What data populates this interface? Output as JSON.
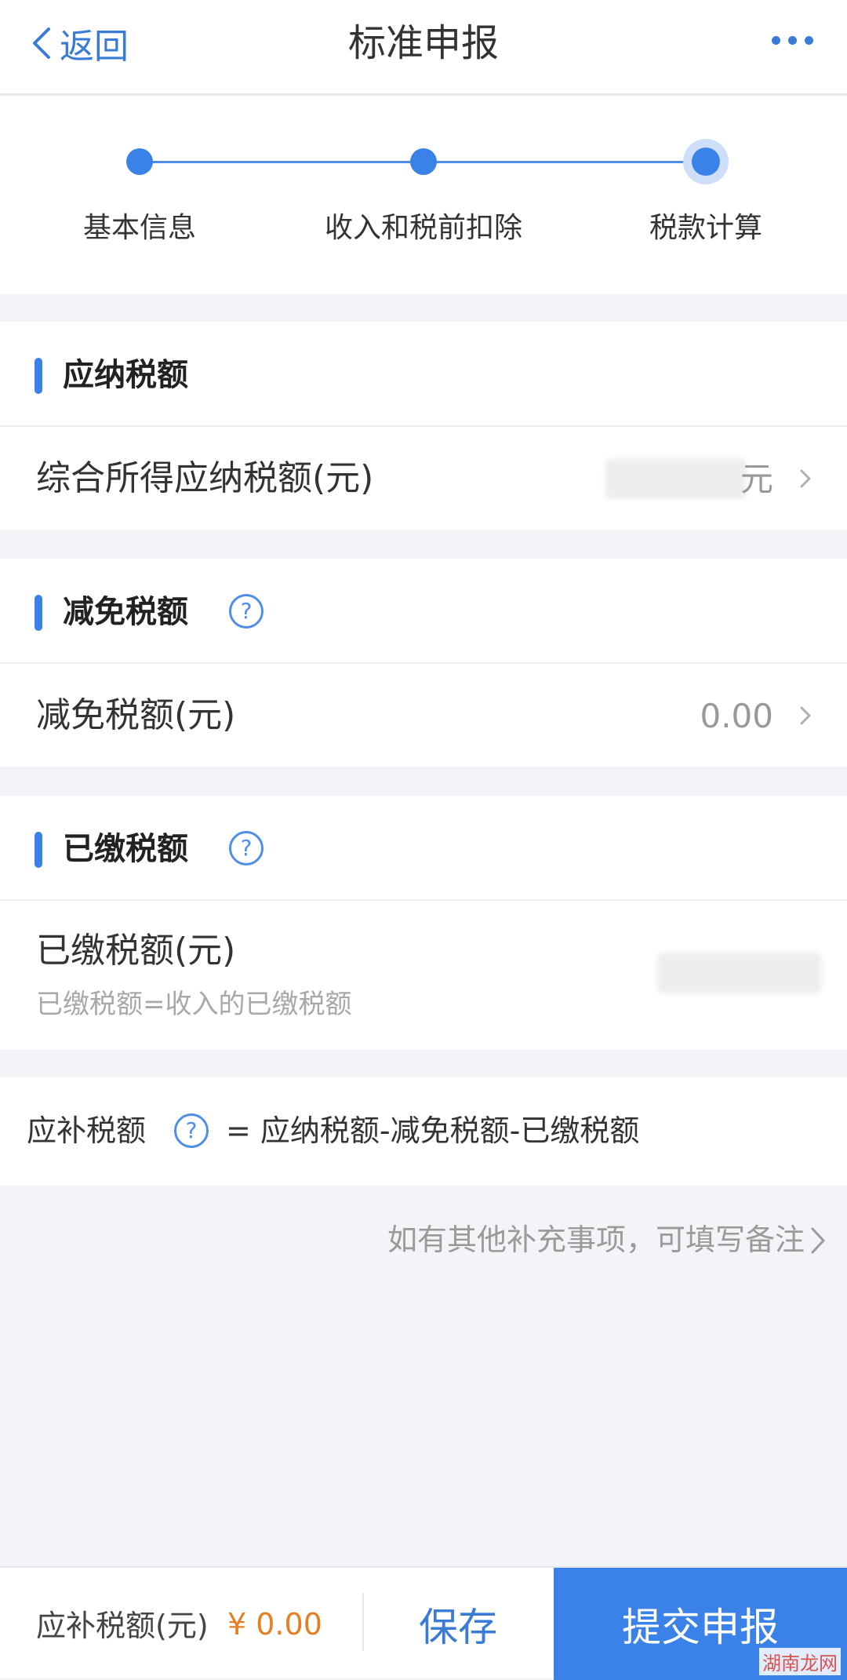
{
  "header": {
    "back_label": "返回",
    "title": "标准申报"
  },
  "stepper": {
    "steps": [
      "基本信息",
      "收入和税前扣除",
      "税款计算"
    ],
    "active_index": 2
  },
  "sections": {
    "payable": {
      "title": "应纳税额",
      "row_label": "综合所得应纳税额(元)",
      "row_unit": "元"
    },
    "reduction": {
      "title": "减免税额",
      "row_label": "减免税额(元)",
      "row_value": "0.00"
    },
    "paid": {
      "title": "已缴税额",
      "row_label": "已缴税额(元)",
      "row_hint": "已缴税额=收入的已缴税额"
    }
  },
  "formula": {
    "label": "应补税额",
    "expression": "= 应纳税额-减免税额-已缴税额"
  },
  "note": {
    "text": "如有其他补充事项，可填写备注"
  },
  "bottom": {
    "label": "应补税额(元)",
    "amount": "¥ 0.00",
    "save_label": "保存",
    "submit_label": "提交申报"
  },
  "watermark": "湖南龙网",
  "colors": {
    "accent": "#3b82e8",
    "amount": "#e67e22"
  }
}
